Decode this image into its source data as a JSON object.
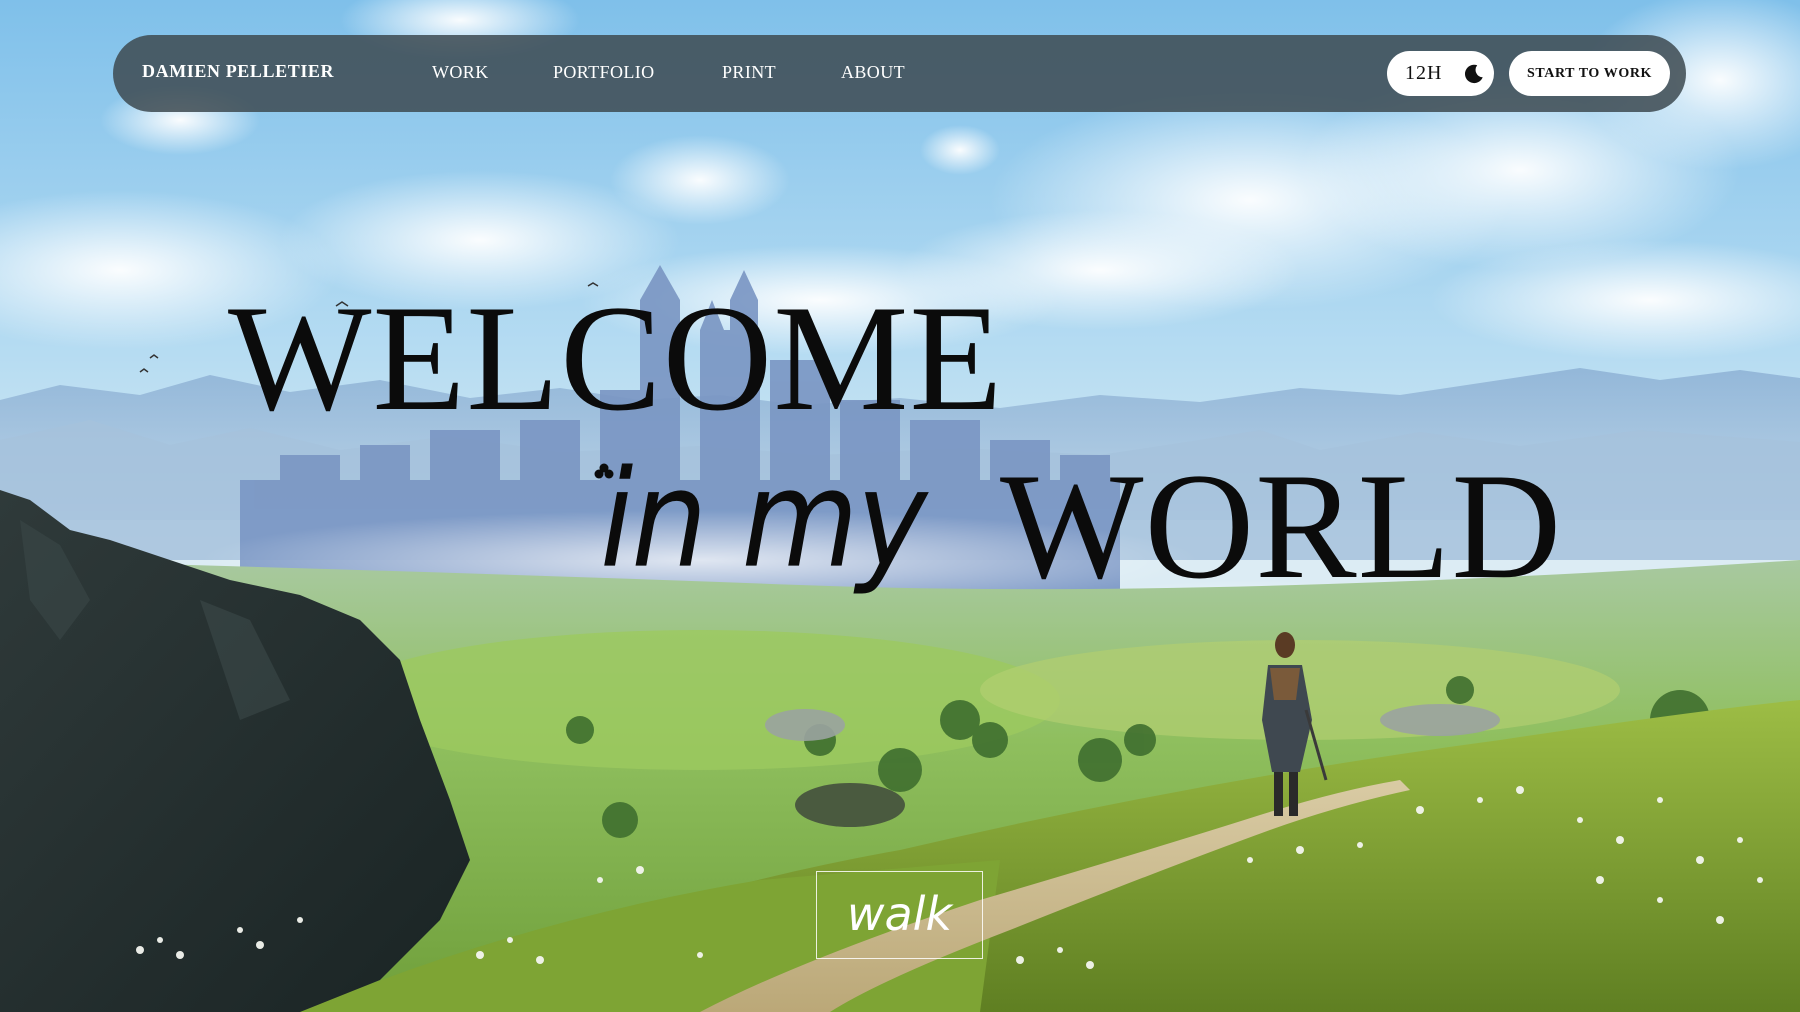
{
  "nav": {
    "brand": "DAMIEN PELLETIER",
    "links": [
      "WORK",
      "PORTFOLIO",
      "PRINT",
      "ABOUT"
    ],
    "clock_label": "12H",
    "clock_icon": "moon-icon",
    "cta_label": "START TO WORK"
  },
  "hero": {
    "line1": "WELCOME",
    "script": "in my",
    "line2": "WORLD"
  },
  "walk_button": {
    "label": "walk"
  },
  "colors": {
    "nav_background": "#3e4a52",
    "pill_background": "#ffffff",
    "title_text": "#0b0b0b",
    "sky": "#9fcbe8",
    "grass": "#8fb43e"
  }
}
